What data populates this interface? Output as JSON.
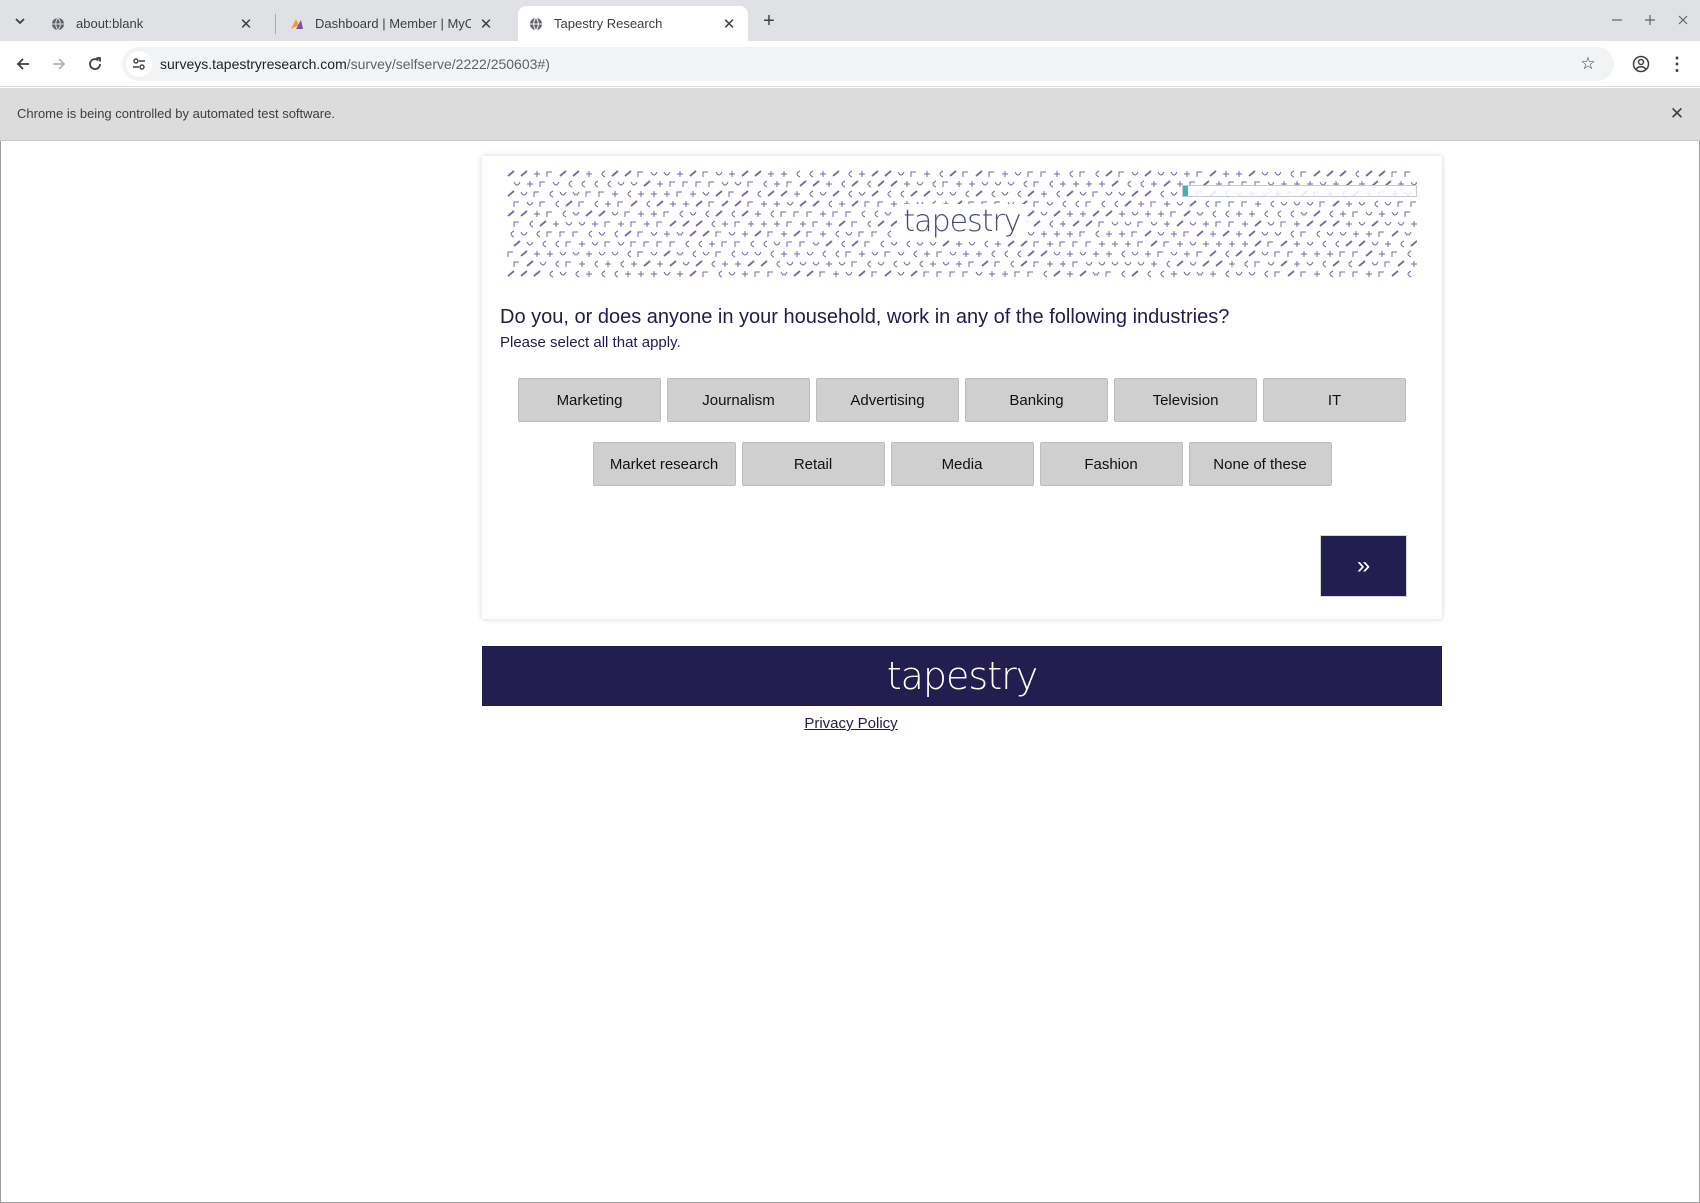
{
  "browser": {
    "tabs": [
      {
        "title": "about:blank",
        "favicon": "globe-icon",
        "active": false
      },
      {
        "title": "Dashboard | Member | MyOpinions",
        "favicon": "myopinions-icon",
        "active": false
      },
      {
        "title": "Tapestry Research",
        "favicon": "globe-icon",
        "active": true
      }
    ],
    "url_host": "surveys.tapestryresearch.com",
    "url_path": "/survey/selfserve/2222/250603#)",
    "infobar_message": "Chrome is being controlled by automated test software."
  },
  "survey": {
    "logo_text": "tapestry",
    "progress_label": "2%",
    "progress_fraction": 0.02,
    "question": "Do you, or does anyone in your household, work in any of the following industries?",
    "instruction": "Please select all that apply.",
    "options_row1": [
      "Marketing",
      "Journalism",
      "Advertising",
      "Banking",
      "Television",
      "IT"
    ],
    "options_row2": [
      "Market research",
      "Retail",
      "Media",
      "Fashion",
      "None of these"
    ],
    "next_label": "»"
  },
  "footer": {
    "logo_text": "tapestry",
    "privacy_link": "Privacy Policy"
  },
  "colors": {
    "brand_navy": "#221e4f",
    "progress_teal": "#3fb6b0",
    "option_gray": "#cfcfcf"
  }
}
